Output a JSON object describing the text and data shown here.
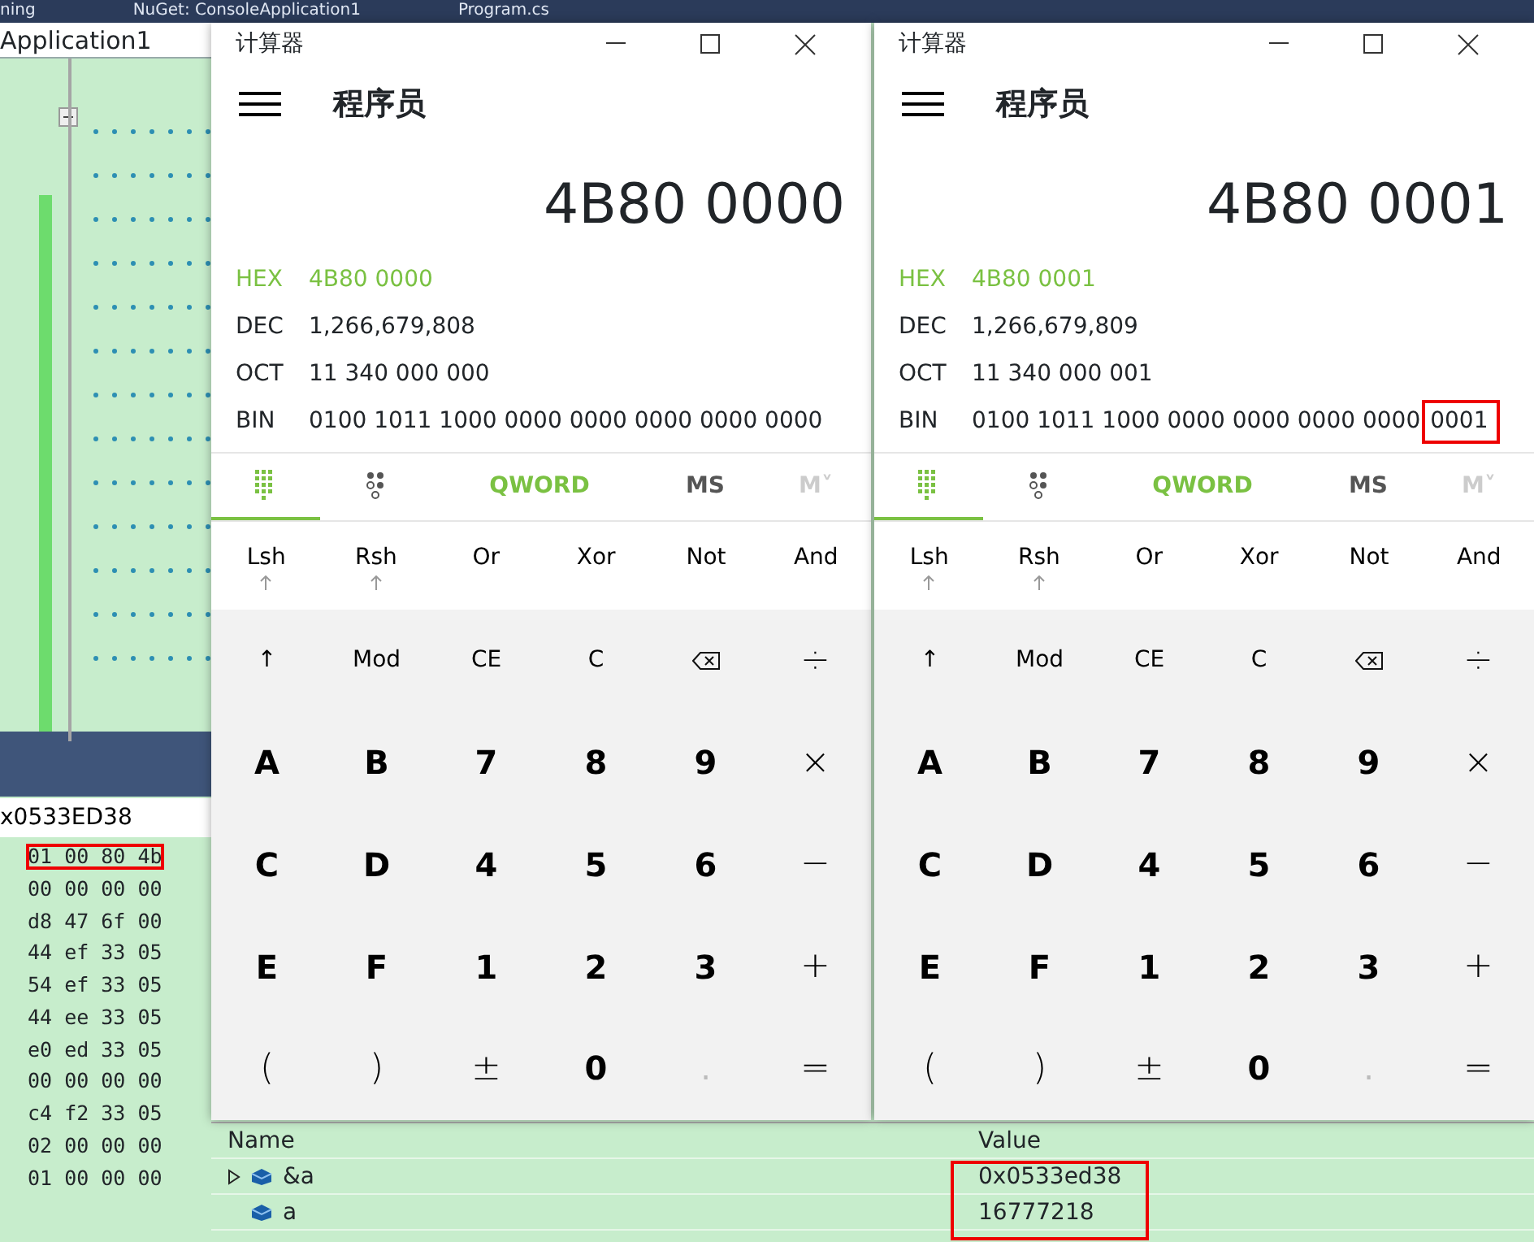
{
  "ide": {
    "tabs": [
      "ning",
      "NuGet: ConsoleApplication1",
      "Program.cs"
    ],
    "project_title": "Application1",
    "memory": {
      "address": "x0533ED38",
      "rows": [
        {
          "bytes": "01 00 80 4b",
          "highlighted": true
        },
        {
          "bytes": "00 00 00 00",
          "highlighted": false
        },
        {
          "bytes": "d8 47 6f 00",
          "highlighted": false
        },
        {
          "bytes": "44 ef 33 05",
          "highlighted": false
        },
        {
          "bytes": "54 ef 33 05",
          "highlighted": false
        },
        {
          "bytes": "44 ee 33 05",
          "highlighted": false
        },
        {
          "bytes": "e0 ed 33 05",
          "highlighted": false
        },
        {
          "bytes": "00 00 00 00",
          "highlighted": false
        },
        {
          "bytes": "c4 f2 33 05",
          "highlighted": false
        },
        {
          "bytes": "02 00 00 00",
          "highlighted": false
        },
        {
          "bytes": "01 00 00 00",
          "highlighted": false
        }
      ]
    },
    "watch": {
      "columns": [
        "Name",
        "Value"
      ],
      "values_highlighted": true,
      "rows": [
        {
          "name": "&a",
          "value": "0x0533ed38",
          "expandable": true
        },
        {
          "name": "a",
          "value": "16777218",
          "expandable": false
        }
      ]
    }
  },
  "calculators": [
    {
      "title": "计算器",
      "mode": "程序员",
      "display": "4B80 0000",
      "radix": [
        {
          "label": "HEX",
          "value": "4B80 0000",
          "selected": true
        },
        {
          "label": "DEC",
          "value": "1,266,679,808",
          "selected": false
        },
        {
          "label": "OCT",
          "value": "11 340 000 000",
          "selected": false
        },
        {
          "label": "BIN",
          "value": "0100 1011 1000 0000 0000 0000 0000 0000",
          "selected": false
        }
      ],
      "word_size": "QWORD",
      "memory_buttons": [
        {
          "label": "MS",
          "disabled": false
        },
        {
          "label": "M˅",
          "disabled": true
        }
      ],
      "bitwise": [
        {
          "label": "Lsh",
          "shift": true
        },
        {
          "label": "Rsh",
          "shift": true
        },
        {
          "label": "Or",
          "shift": false
        },
        {
          "label": "Xor",
          "shift": false
        },
        {
          "label": "Not",
          "shift": false
        },
        {
          "label": "And",
          "shift": false
        }
      ],
      "keys": [
        {
          "label": "↑",
          "kind": "fn"
        },
        {
          "label": "Mod",
          "kind": "fn"
        },
        {
          "label": "CE",
          "kind": "fn"
        },
        {
          "label": "C",
          "kind": "fn"
        },
        {
          "kind": "backspace"
        },
        {
          "label": "÷",
          "kind": "op"
        },
        {
          "label": "A",
          "kind": "digit"
        },
        {
          "label": "B",
          "kind": "digit"
        },
        {
          "label": "7",
          "kind": "digit"
        },
        {
          "label": "8",
          "kind": "digit"
        },
        {
          "label": "9",
          "kind": "digit"
        },
        {
          "label": "×",
          "kind": "op"
        },
        {
          "label": "C",
          "kind": "digit"
        },
        {
          "label": "D",
          "kind": "digit"
        },
        {
          "label": "4",
          "kind": "digit"
        },
        {
          "label": "5",
          "kind": "digit"
        },
        {
          "label": "6",
          "kind": "digit"
        },
        {
          "label": "−",
          "kind": "op"
        },
        {
          "label": "E",
          "kind": "digit"
        },
        {
          "label": "F",
          "kind": "digit"
        },
        {
          "label": "1",
          "kind": "digit"
        },
        {
          "label": "2",
          "kind": "digit"
        },
        {
          "label": "3",
          "kind": "digit"
        },
        {
          "label": "+",
          "kind": "op"
        },
        {
          "label": "(",
          "kind": "op"
        },
        {
          "label": ")",
          "kind": "op"
        },
        {
          "label": "±",
          "kind": "op"
        },
        {
          "label": "0",
          "kind": "digit"
        },
        {
          "label": ".",
          "kind": "disabled"
        },
        {
          "label": "=",
          "kind": "op"
        }
      ]
    },
    {
      "title": "计算器",
      "mode": "程序员",
      "display": "4B80 0001",
      "radix": [
        {
          "label": "HEX",
          "value": "4B80 0001",
          "selected": true
        },
        {
          "label": "DEC",
          "value": "1,266,679,809",
          "selected": false
        },
        {
          "label": "OCT",
          "value": "11 340 000 001",
          "selected": false
        },
        {
          "label": "BIN",
          "value": "0100 1011 1000 0000 0000 0000 0000",
          "marked": "0001",
          "selected": false
        }
      ],
      "word_size": "QWORD",
      "memory_buttons": [
        {
          "label": "MS",
          "disabled": false
        },
        {
          "label": "M˅",
          "disabled": true
        }
      ],
      "bitwise": [
        {
          "label": "Lsh",
          "shift": true
        },
        {
          "label": "Rsh",
          "shift": true
        },
        {
          "label": "Or",
          "shift": false
        },
        {
          "label": "Xor",
          "shift": false
        },
        {
          "label": "Not",
          "shift": false
        },
        {
          "label": "And",
          "shift": false
        }
      ],
      "keys": [
        {
          "label": "↑",
          "kind": "fn"
        },
        {
          "label": "Mod",
          "kind": "fn"
        },
        {
          "label": "CE",
          "kind": "fn"
        },
        {
          "label": "C",
          "kind": "fn"
        },
        {
          "kind": "backspace"
        },
        {
          "label": "÷",
          "kind": "op"
        },
        {
          "label": "A",
          "kind": "digit"
        },
        {
          "label": "B",
          "kind": "digit"
        },
        {
          "label": "7",
          "kind": "digit"
        },
        {
          "label": "8",
          "kind": "digit"
        },
        {
          "label": "9",
          "kind": "digit"
        },
        {
          "label": "×",
          "kind": "op"
        },
        {
          "label": "C",
          "kind": "digit"
        },
        {
          "label": "D",
          "kind": "digit"
        },
        {
          "label": "4",
          "kind": "digit"
        },
        {
          "label": "5",
          "kind": "digit"
        },
        {
          "label": "6",
          "kind": "digit"
        },
        {
          "label": "−",
          "kind": "op"
        },
        {
          "label": "E",
          "kind": "digit"
        },
        {
          "label": "F",
          "kind": "digit"
        },
        {
          "label": "1",
          "kind": "digit"
        },
        {
          "label": "2",
          "kind": "digit"
        },
        {
          "label": "3",
          "kind": "digit"
        },
        {
          "label": "+",
          "kind": "op"
        },
        {
          "label": "(",
          "kind": "op"
        },
        {
          "label": ")",
          "kind": "op"
        },
        {
          "label": "±",
          "kind": "op"
        },
        {
          "label": "0",
          "kind": "digit"
        },
        {
          "label": ".",
          "kind": "disabled"
        },
        {
          "label": "=",
          "kind": "op"
        }
      ]
    }
  ]
}
